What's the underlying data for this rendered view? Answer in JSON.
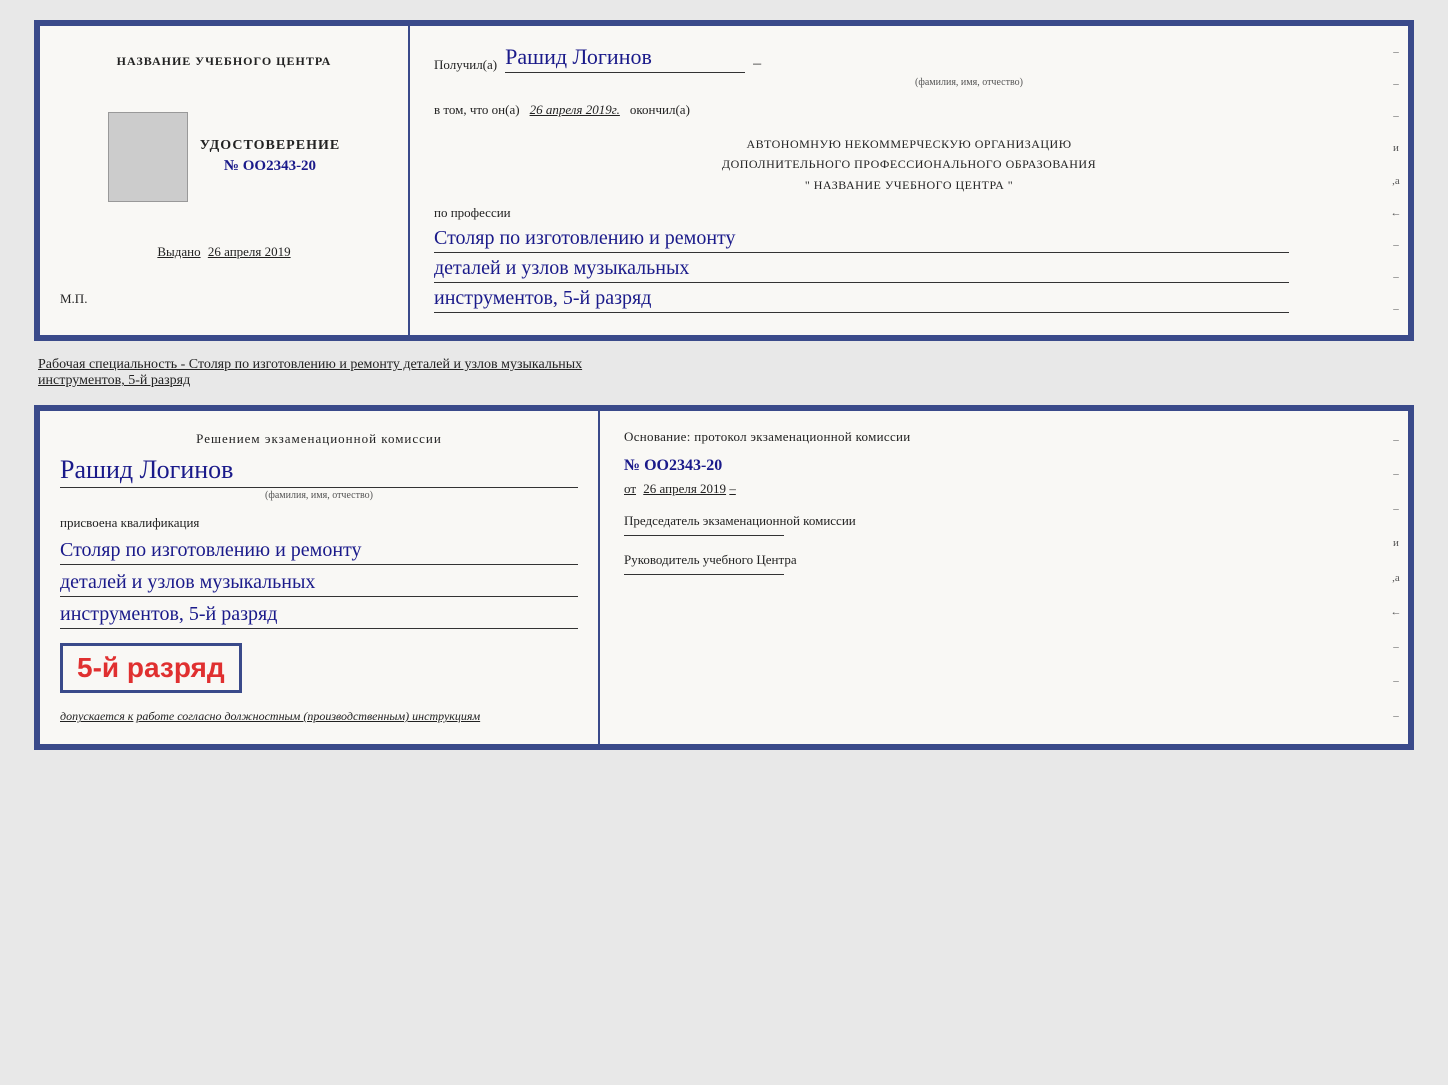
{
  "page": {
    "background_color": "#e8e8e8"
  },
  "top_card": {
    "left": {
      "org_name_label": "НАЗВАНИЕ УЧЕБНОГО ЦЕНТРА",
      "udostoverenie_label": "УДОСТОВЕРЕНИЕ",
      "number": "№ OO2343-20",
      "issued_label": "Выдано",
      "issued_date": "26 апреля 2019",
      "mp_label": "М.П."
    },
    "right": {
      "received_label": "Получил(а)",
      "recipient_name": "Рашид Логинов",
      "name_hint": "(фамилия, имя, отчество)",
      "date_prefix": "в том, что он(а)",
      "date_value": "26 апреля 2019г.",
      "finished_label": "окончил(а)",
      "org_line1": "АВТОНОМНУЮ НЕКОММЕРЧЕСКУЮ ОРГАНИЗАЦИЮ",
      "org_line2": "ДОПОЛНИТЕЛЬНОГО ПРОФЕССИОНАЛЬНОГО ОБРАЗОВАНИЯ",
      "org_line3": "\"   НАЗВАНИЕ УЧЕБНОГО ЦЕНТРА   \"",
      "profession_label": "по профессии",
      "profession_line1": "Столяр по изготовлению и ремонту",
      "profession_line2": "деталей и узлов музыкальных",
      "profession_line3": "инструментов, 5-й разряд",
      "dash_items": [
        "-",
        "-",
        "-",
        "и",
        ",а",
        "←",
        "-",
        "-",
        "-"
      ]
    }
  },
  "specialty_text": {
    "prefix": "Рабочая специальность - Столяр по изготовлению и ремонту деталей и узлов музыкальных",
    "underlined": "инструментов, 5-й разряд"
  },
  "bottom_card": {
    "left": {
      "decision_text": "Решением  экзаменационной  комиссии",
      "person_name": "Рашид Логинов",
      "name_hint": "(фамилия, имя, отчество)",
      "assigned_text": "присвоена квалификация",
      "qualification_line1": "Столяр по изготовлению и ремонту",
      "qualification_line2": "деталей и узлов музыкальных",
      "qualification_line3": "инструментов, 5-й разряд",
      "rank_display": "5-й разряд",
      "allowed_prefix": "допускается к",
      "allowed_text": "работе согласно должностным (производственным) инструкциям"
    },
    "right": {
      "basis_label": "Основание:  протокол  экзаменационной  комиссии",
      "protocol_number": "№ OO2343-20",
      "from_prefix": "от",
      "from_date": "26 апреля 2019",
      "chairman_label": "Председатель экзаменационной комиссии",
      "head_label": "Руководитель учебного Центра",
      "dash_items": [
        "-",
        "-",
        "-",
        "и",
        ",а",
        "←",
        "-",
        "-",
        "-"
      ]
    }
  }
}
